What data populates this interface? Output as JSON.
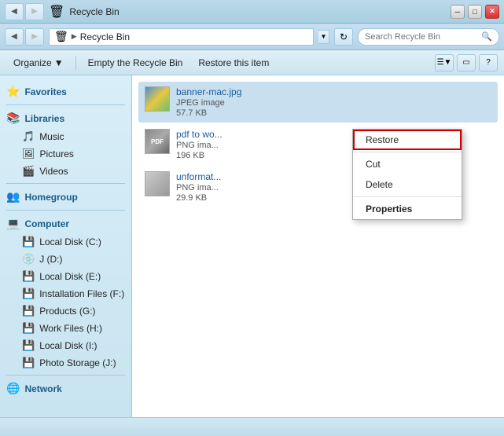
{
  "titlebar": {
    "title": "Recycle Bin",
    "btn_min": "─",
    "btn_max": "□",
    "btn_close": "✕"
  },
  "addressbar": {
    "breadcrumb_icon": "🗑",
    "breadcrumb_arrow": "▶",
    "breadcrumb_text": "Recycle Bin",
    "refresh_icon": "↻",
    "search_placeholder": "Search Recycle Bin",
    "search_icon": "🔍"
  },
  "toolbar": {
    "organize_label": "Organize",
    "organize_arrow": "▼",
    "empty_recycle_label": "Empty the Recycle Bin",
    "restore_label": "Restore this item",
    "view_icon": "☰",
    "view_arrow": "▼",
    "panel_icon": "▭",
    "help_icon": "?"
  },
  "sidebar": {
    "favorites_label": "Favorites",
    "favorites_icon": "⭐",
    "libraries_label": "Libraries",
    "libraries_icon": "📚",
    "music_label": "Music",
    "music_icon": "🎵",
    "pictures_label": "Pictures",
    "pictures_icon": "🖼",
    "videos_label": "Videos",
    "videos_icon": "🎬",
    "homegroup_label": "Homegroup",
    "homegroup_icon": "👥",
    "computer_label": "Computer",
    "computer_icon": "💻",
    "drives": [
      {
        "label": "Local Disk (C:)",
        "icon": "💾"
      },
      {
        "label": "J (D:)",
        "icon": "💿"
      },
      {
        "label": "Local Disk (E:)",
        "icon": "💾"
      },
      {
        "label": "Installation Files (F:)",
        "icon": "💾"
      },
      {
        "label": "Products (G:)",
        "icon": "💾"
      },
      {
        "label": "Work Files (H:)",
        "icon": "💾"
      },
      {
        "label": "Local Disk (I:)",
        "icon": "💾"
      },
      {
        "label": "Photo Storage (J:)",
        "icon": "💾"
      }
    ],
    "network_label": "Network",
    "network_icon": "🌐"
  },
  "files": [
    {
      "name": "banner-mac.jpg",
      "type": "JPEG image",
      "size": "57.7 KB",
      "thumb": "banner"
    },
    {
      "name": "pdf to wo...",
      "type": "PNG ima...",
      "size": "196 KB",
      "thumb": "pdf"
    },
    {
      "name": "unformat...",
      "type": "PNG ima...",
      "size": "29.9 KB",
      "thumb": "unformat"
    }
  ],
  "context_menu": {
    "restore_label": "Restore",
    "cut_label": "Cut",
    "delete_label": "Delete",
    "properties_label": "Properties"
  },
  "statusbar": {
    "text": ""
  }
}
